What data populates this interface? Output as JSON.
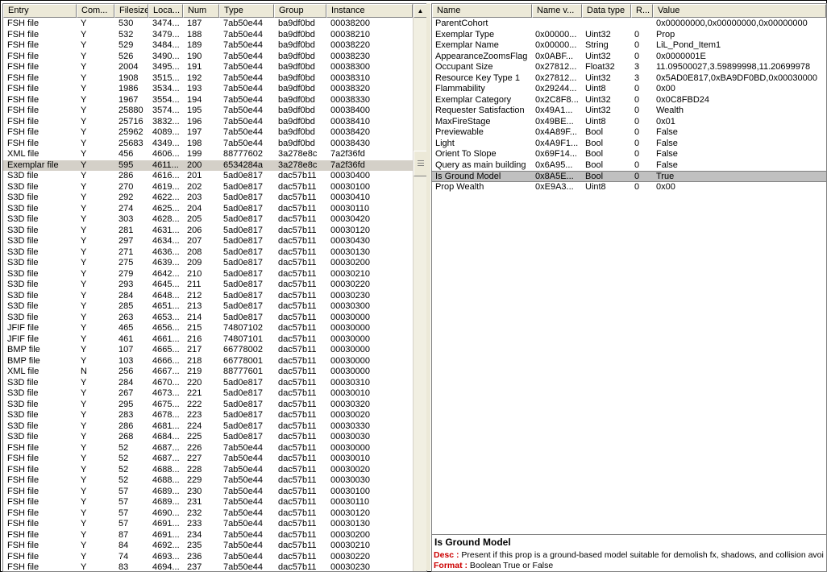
{
  "entries": {
    "columns": [
      "Entry",
      "Com...",
      "Filesize",
      "Loca...",
      "Num",
      "Type",
      "Group",
      "Instance"
    ],
    "selected_index": 13,
    "rows": [
      [
        "FSH file",
        "Y",
        "530",
        "3474...",
        "187",
        "7ab50e44",
        "ba9df0bd",
        "00038200"
      ],
      [
        "FSH file",
        "Y",
        "532",
        "3479...",
        "188",
        "7ab50e44",
        "ba9df0bd",
        "00038210"
      ],
      [
        "FSH file",
        "Y",
        "529",
        "3484...",
        "189",
        "7ab50e44",
        "ba9df0bd",
        "00038220"
      ],
      [
        "FSH file",
        "Y",
        "526",
        "3490...",
        "190",
        "7ab50e44",
        "ba9df0bd",
        "00038230"
      ],
      [
        "FSH file",
        "Y",
        "2004",
        "3495...",
        "191",
        "7ab50e44",
        "ba9df0bd",
        "00038300"
      ],
      [
        "FSH file",
        "Y",
        "1908",
        "3515...",
        "192",
        "7ab50e44",
        "ba9df0bd",
        "00038310"
      ],
      [
        "FSH file",
        "Y",
        "1986",
        "3534...",
        "193",
        "7ab50e44",
        "ba9df0bd",
        "00038320"
      ],
      [
        "FSH file",
        "Y",
        "1967",
        "3554...",
        "194",
        "7ab50e44",
        "ba9df0bd",
        "00038330"
      ],
      [
        "FSH file",
        "Y",
        "25880",
        "3574...",
        "195",
        "7ab50e44",
        "ba9df0bd",
        "00038400"
      ],
      [
        "FSH file",
        "Y",
        "25716",
        "3832...",
        "196",
        "7ab50e44",
        "ba9df0bd",
        "00038410"
      ],
      [
        "FSH file",
        "Y",
        "25962",
        "4089...",
        "197",
        "7ab50e44",
        "ba9df0bd",
        "00038420"
      ],
      [
        "FSH file",
        "Y",
        "25683",
        "4349...",
        "198",
        "7ab50e44",
        "ba9df0bd",
        "00038430"
      ],
      [
        "XML file",
        "Y",
        "456",
        "4606...",
        "199",
        "88777602",
        "3a278e8c",
        "7a2f36fd"
      ],
      [
        "Exemplar file",
        "Y",
        "595",
        "4611...",
        "200",
        "6534284a",
        "3a278e8c",
        "7a2f36fd"
      ],
      [
        "S3D file",
        "Y",
        "286",
        "4616...",
        "201",
        "5ad0e817",
        "dac57b11",
        "00030400"
      ],
      [
        "S3D file",
        "Y",
        "270",
        "4619...",
        "202",
        "5ad0e817",
        "dac57b11",
        "00030100"
      ],
      [
        "S3D file",
        "Y",
        "292",
        "4622...",
        "203",
        "5ad0e817",
        "dac57b11",
        "00030410"
      ],
      [
        "S3D file",
        "Y",
        "274",
        "4625...",
        "204",
        "5ad0e817",
        "dac57b11",
        "00030110"
      ],
      [
        "S3D file",
        "Y",
        "303",
        "4628...",
        "205",
        "5ad0e817",
        "dac57b11",
        "00030420"
      ],
      [
        "S3D file",
        "Y",
        "281",
        "4631...",
        "206",
        "5ad0e817",
        "dac57b11",
        "00030120"
      ],
      [
        "S3D file",
        "Y",
        "297",
        "4634...",
        "207",
        "5ad0e817",
        "dac57b11",
        "00030430"
      ],
      [
        "S3D file",
        "Y",
        "271",
        "4636...",
        "208",
        "5ad0e817",
        "dac57b11",
        "00030130"
      ],
      [
        "S3D file",
        "Y",
        "275",
        "4639...",
        "209",
        "5ad0e817",
        "dac57b11",
        "00030200"
      ],
      [
        "S3D file",
        "Y",
        "279",
        "4642...",
        "210",
        "5ad0e817",
        "dac57b11",
        "00030210"
      ],
      [
        "S3D file",
        "Y",
        "293",
        "4645...",
        "211",
        "5ad0e817",
        "dac57b11",
        "00030220"
      ],
      [
        "S3D file",
        "Y",
        "284",
        "4648...",
        "212",
        "5ad0e817",
        "dac57b11",
        "00030230"
      ],
      [
        "S3D file",
        "Y",
        "285",
        "4651...",
        "213",
        "5ad0e817",
        "dac57b11",
        "00030300"
      ],
      [
        "S3D file",
        "Y",
        "263",
        "4653...",
        "214",
        "5ad0e817",
        "dac57b11",
        "00030000"
      ],
      [
        "JFIF file",
        "Y",
        "465",
        "4656...",
        "215",
        "74807102",
        "dac57b11",
        "00030000"
      ],
      [
        "JFIF file",
        "Y",
        "461",
        "4661...",
        "216",
        "74807101",
        "dac57b11",
        "00030000"
      ],
      [
        "BMP file",
        "Y",
        "107",
        "4665...",
        "217",
        "66778002",
        "dac57b11",
        "00030000"
      ],
      [
        "BMP file",
        "Y",
        "103",
        "4666...",
        "218",
        "66778001",
        "dac57b11",
        "00030000"
      ],
      [
        "XML file",
        "N",
        "256",
        "4667...",
        "219",
        "88777601",
        "dac57b11",
        "00030000"
      ],
      [
        "S3D file",
        "Y",
        "284",
        "4670...",
        "220",
        "5ad0e817",
        "dac57b11",
        "00030310"
      ],
      [
        "S3D file",
        "Y",
        "267",
        "4673...",
        "221",
        "5ad0e817",
        "dac57b11",
        "00030010"
      ],
      [
        "S3D file",
        "Y",
        "295",
        "4675...",
        "222",
        "5ad0e817",
        "dac57b11",
        "00030320"
      ],
      [
        "S3D file",
        "Y",
        "283",
        "4678...",
        "223",
        "5ad0e817",
        "dac57b11",
        "00030020"
      ],
      [
        "S3D file",
        "Y",
        "286",
        "4681...",
        "224",
        "5ad0e817",
        "dac57b11",
        "00030330"
      ],
      [
        "S3D file",
        "Y",
        "268",
        "4684...",
        "225",
        "5ad0e817",
        "dac57b11",
        "00030030"
      ],
      [
        "FSH file",
        "Y",
        "52",
        "4687...",
        "226",
        "7ab50e44",
        "dac57b11",
        "00030000"
      ],
      [
        "FSH file",
        "Y",
        "52",
        "4687...",
        "227",
        "7ab50e44",
        "dac57b11",
        "00030010"
      ],
      [
        "FSH file",
        "Y",
        "52",
        "4688...",
        "228",
        "7ab50e44",
        "dac57b11",
        "00030020"
      ],
      [
        "FSH file",
        "Y",
        "52",
        "4688...",
        "229",
        "7ab50e44",
        "dac57b11",
        "00030030"
      ],
      [
        "FSH file",
        "Y",
        "57",
        "4689...",
        "230",
        "7ab50e44",
        "dac57b11",
        "00030100"
      ],
      [
        "FSH file",
        "Y",
        "57",
        "4689...",
        "231",
        "7ab50e44",
        "dac57b11",
        "00030110"
      ],
      [
        "FSH file",
        "Y",
        "57",
        "4690...",
        "232",
        "7ab50e44",
        "dac57b11",
        "00030120"
      ],
      [
        "FSH file",
        "Y",
        "57",
        "4691...",
        "233",
        "7ab50e44",
        "dac57b11",
        "00030130"
      ],
      [
        "FSH file",
        "Y",
        "87",
        "4691...",
        "234",
        "7ab50e44",
        "dac57b11",
        "00030200"
      ],
      [
        "FSH file",
        "Y",
        "84",
        "4692...",
        "235",
        "7ab50e44",
        "dac57b11",
        "00030210"
      ],
      [
        "FSH file",
        "Y",
        "74",
        "4693...",
        "236",
        "7ab50e44",
        "dac57b11",
        "00030220"
      ],
      [
        "FSH file",
        "Y",
        "83",
        "4694...",
        "237",
        "7ab50e44",
        "dac57b11",
        "00030230"
      ]
    ]
  },
  "properties": {
    "columns": [
      "Name",
      "Name v...",
      "Data type",
      "R...",
      "Value"
    ],
    "selected_index": 14,
    "rows": [
      [
        "ParentCohort",
        "",
        "",
        "",
        "0x00000000,0x00000000,0x00000000"
      ],
      [
        "Exemplar Type",
        "0x00000...",
        "Uint32",
        "0",
        "Prop"
      ],
      [
        "Exemplar Name",
        "0x00000...",
        "String",
        "0",
        "LiL_Pond_Item1"
      ],
      [
        "AppearanceZoomsFlag",
        "0x0ABF...",
        "Uint32",
        "0",
        "0x0000001E"
      ],
      [
        "Occupant Size",
        "0x27812...",
        "Float32",
        "3",
        "11.09500027,3.59899998,11.20699978"
      ],
      [
        "Resource Key Type 1",
        "0x27812...",
        "Uint32",
        "3",
        "0x5AD0E817,0xBA9DF0BD,0x00030000"
      ],
      [
        "Flammability",
        "0x29244...",
        "Uint8",
        "0",
        "0x00"
      ],
      [
        "Exemplar Category",
        "0x2C8F8...",
        "Uint32",
        "0",
        "0x0C8FBD24"
      ],
      [
        "Requester Satisfaction",
        "0x49A1...",
        "Uint32",
        "0",
        "Wealth"
      ],
      [
        "MaxFireStage",
        "0x49BE...",
        "Uint8",
        "0",
        "0x01"
      ],
      [
        "Previewable",
        "0x4A89F...",
        "Bool",
        "0",
        "False"
      ],
      [
        "Light",
        "0x4A9F1...",
        "Bool",
        "0",
        "False"
      ],
      [
        "Orient To Slope",
        "0x69F14...",
        "Bool",
        "0",
        "False"
      ],
      [
        "Query as main building",
        "0x6A95...",
        "Bool",
        "0",
        "False"
      ],
      [
        "Is Ground Model",
        "0x8A5E...",
        "Bool",
        "0",
        "True"
      ],
      [
        "Prop Wealth",
        "0xE9A3...",
        "Uint8",
        "0",
        "0x00"
      ]
    ]
  },
  "description": {
    "title": "Is Ground Model",
    "desc_label": "Desc :",
    "desc_text": " Present if this prop is a ground-based model suitable for demolish fx, shadows, and collision avoi",
    "format_label": "Format :",
    "format_text": " Boolean True or False"
  },
  "scrollbar": {
    "up_glyph": "▲"
  }
}
